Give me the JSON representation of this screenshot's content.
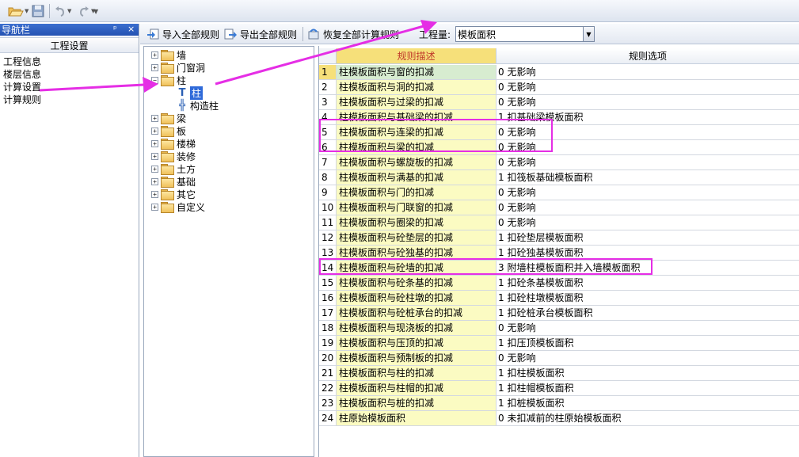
{
  "quick_toolbar": {
    "icons": [
      "open-folder-icon",
      "save-icon",
      "undo-icon",
      "redo-icon"
    ]
  },
  "nav": {
    "title": "导航栏",
    "pin_glyph": "ᵖ",
    "close_glyph": "×",
    "group": "工程设置",
    "items": [
      "工程信息",
      "楼层信息",
      "计算设置",
      "计算规则"
    ]
  },
  "toolbar": {
    "import_label": "导入全部规则",
    "export_label": "导出全部规则",
    "restore_label": "恢复全部计算规则",
    "quantity_label": "工程量:",
    "quantity_value": "模板面积"
  },
  "tree": {
    "nodes": [
      {
        "label": "墙",
        "expander": "+"
      },
      {
        "label": "门窗洞",
        "expander": "+"
      },
      {
        "label": "柱",
        "expander": "−"
      },
      {
        "label": "柱",
        "child": true,
        "selected": true
      },
      {
        "label": "构造柱",
        "child": true
      },
      {
        "label": "梁",
        "expander": "+"
      },
      {
        "label": "板",
        "expander": "+"
      },
      {
        "label": "楼梯",
        "expander": "+"
      },
      {
        "label": "装修",
        "expander": "+"
      },
      {
        "label": "土方",
        "expander": "+"
      },
      {
        "label": "基础",
        "expander": "+"
      },
      {
        "label": "其它",
        "expander": "+"
      },
      {
        "label": "自定义",
        "expander": "+"
      }
    ]
  },
  "grid": {
    "headers": [
      "规则描述",
      "规则选项"
    ],
    "rows": [
      {
        "no": "1",
        "desc": "柱模板面积与窗的扣减",
        "opt": "0   无影响"
      },
      {
        "no": "2",
        "desc": "柱模板面积与洞的扣减",
        "opt": "0   无影响"
      },
      {
        "no": "3",
        "desc": "柱模板面积与过梁的扣减",
        "opt": "0   无影响"
      },
      {
        "no": "4",
        "desc": "柱模板面积与基础梁的扣减",
        "opt": "1  扣基础梁模板面积"
      },
      {
        "no": "5",
        "desc": "柱模板面积与连梁的扣减",
        "opt": "0   无影响"
      },
      {
        "no": "6",
        "desc": "柱模板面积与梁的扣减",
        "opt": "0   无影响"
      },
      {
        "no": "7",
        "desc": "柱模板面积与螺旋板的扣减",
        "opt": "0   无影响"
      },
      {
        "no": "8",
        "desc": "柱模板面积与满基的扣减",
        "opt": "1  扣筏板基础模板面积"
      },
      {
        "no": "9",
        "desc": "柱模板面积与门的扣减",
        "opt": "0   无影响"
      },
      {
        "no": "10",
        "desc": "柱模板面积与门联窗的扣减",
        "opt": "0   无影响"
      },
      {
        "no": "11",
        "desc": "柱模板面积与圈梁的扣减",
        "opt": "0   无影响"
      },
      {
        "no": "12",
        "desc": "柱模板面积与砼垫层的扣减",
        "opt": "1  扣砼垫层模板面积"
      },
      {
        "no": "13",
        "desc": "柱模板面积与砼独基的扣减",
        "opt": "1  扣砼独基模板面积"
      },
      {
        "no": "14",
        "desc": "柱模板面积与砼墙的扣减",
        "opt": "3  附墙柱模板面积并入墙模板面积"
      },
      {
        "no": "15",
        "desc": "柱模板面积与砼条基的扣减",
        "opt": "1  扣砼条基模板面积"
      },
      {
        "no": "16",
        "desc": "柱模板面积与砼柱墩的扣减",
        "opt": "1  扣砼柱墩模板面积"
      },
      {
        "no": "17",
        "desc": "柱模板面积与砼桩承台的扣减",
        "opt": "1  扣砼桩承台模板面积"
      },
      {
        "no": "18",
        "desc": "柱模板面积与现浇板的扣减",
        "opt": "0   无影响"
      },
      {
        "no": "19",
        "desc": "柱模板面积与压顶的扣减",
        "opt": "1  扣压顶模板面积"
      },
      {
        "no": "20",
        "desc": "柱模板面积与预制板的扣减",
        "opt": "0   无影响"
      },
      {
        "no": "21",
        "desc": "柱模板面积与柱的扣减",
        "opt": "1  扣柱模板面积"
      },
      {
        "no": "22",
        "desc": "柱模板面积与柱帽的扣减",
        "opt": "1  扣柱帽模板面积"
      },
      {
        "no": "23",
        "desc": "柱模板面积与桩的扣减",
        "opt": "1  扣桩模板面积"
      },
      {
        "no": "24",
        "desc": "柱原始模板面积",
        "opt": "0  未扣减前的柱原始模板面积"
      }
    ]
  },
  "colors": {
    "annotation": "#e52ee5",
    "desc_cell": "#fbfbc2",
    "header": "#f6e07a",
    "selection": "#2f6ad9"
  }
}
